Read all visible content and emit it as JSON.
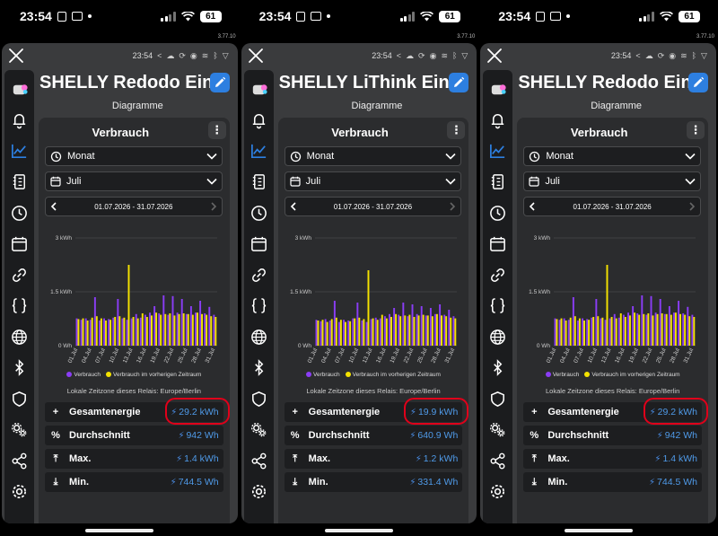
{
  "panels": [
    {
      "status": {
        "time": "23:54",
        "battery": "61"
      },
      "version": "3.77.10",
      "topbar_time": "23:54",
      "title": "SHELLY Redodo Ein...",
      "subtitle": "Diagramme",
      "card_title": "Verbrauch",
      "period_select": "Monat",
      "month_select": "Juli",
      "date_range": "01.07.2026 - 31.07.2026",
      "y_ticks": [
        "3 kWh",
        "1.5 kWh",
        "0 Wh"
      ],
      "x_ticks": [
        "01.Jul",
        "04.Jul",
        "07.Jul",
        "10.Jul",
        "13.Jul",
        "16.Jul",
        "19.Jul",
        "22.Jul",
        "25.Jul",
        "28.Jul",
        "31.Jul"
      ],
      "legend": {
        "current": "Verbrauch",
        "previous": "Verbrauch im vorherigen Zeitraum"
      },
      "timezone": "Lokale Zeitzone dieses Relais: Europe/Berlin",
      "stats": [
        {
          "label": "Gesamtenergie",
          "value": "29.2 kWh"
        },
        {
          "label": "Durchschnitt",
          "value": "942 Wh"
        },
        {
          "label": "Max.",
          "value": "1.4 kWh"
        },
        {
          "label": "Min.",
          "value": "744.5 Wh"
        }
      ],
      "chart_data": {
        "type": "bar",
        "ylim": [
          0,
          3000
        ],
        "unit": "Wh",
        "series": [
          {
            "name": "Verbrauch",
            "values": [
              760,
              720,
              760,
              720,
              1350,
              700,
              760,
              740,
              780,
              1300,
              760,
              720,
              760,
              880,
              780,
              860,
              920,
              1100,
              900,
              1400,
              860,
              1380,
              920,
              1300,
              880,
              1100,
              920,
              1250,
              900,
              1080,
              860
            ]
          },
          {
            "name": "Verbrauch im vorherigen Zeitraum",
            "values": [
              740,
              760,
              700,
              780,
              820,
              760,
              700,
              720,
              800,
              820,
              780,
              2250,
              800,
              760,
              900,
              800,
              840,
              920,
              860,
              880,
              900,
              840,
              880,
              900,
              880,
              860,
              920,
              880,
              860,
              820,
              800
            ]
          }
        ]
      }
    },
    {
      "status": {
        "time": "23:54",
        "battery": "61"
      },
      "version": "3.77.10",
      "topbar_time": "23:54",
      "title": "SHELLY LiThink Ein...",
      "subtitle": "Diagramme",
      "card_title": "Verbrauch",
      "period_select": "Monat",
      "month_select": "Juli",
      "date_range": "01.07.2026 - 31.07.2026",
      "y_ticks": [
        "3 kWh",
        "1.5 kWh",
        "0 Wh"
      ],
      "x_ticks": [
        "01.Jul",
        "04.Jul",
        "07.Jul",
        "10.Jul",
        "13.Jul",
        "16.Jul",
        "19.Jul",
        "22.Jul",
        "25.Jul",
        "28.Jul",
        "31.Jul"
      ],
      "legend": {
        "current": "Verbrauch",
        "previous": "Verbrauch im vorherigen Zeitraum"
      },
      "timezone": "Lokale Zeitzone dieses Relais: Europe/Berlin",
      "stats": [
        {
          "label": "Gesamtenergie",
          "value": "19.9 kWh"
        },
        {
          "label": "Durchschnitt",
          "value": "640.9 Wh"
        },
        {
          "label": "Max.",
          "value": "1.2 kWh"
        },
        {
          "label": "Min.",
          "value": "331.4 Wh"
        }
      ],
      "chart_data": {
        "type": "bar",
        "ylim": [
          0,
          3000
        ],
        "unit": "Wh",
        "series": [
          {
            "name": "Verbrauch",
            "values": [
              720,
              680,
              740,
              700,
              1250,
              660,
              720,
              700,
              760,
              1200,
              700,
              660,
              740,
              780,
              760,
              820,
              880,
              1050,
              860,
              1200,
              820,
              1150,
              880,
              1100,
              840,
              1050,
              880,
              1150,
              860,
              1000,
              820
            ]
          },
          {
            "name": "Verbrauch im vorherigen Zeitraum",
            "values": [
              700,
              720,
              660,
              740,
              780,
              720,
              660,
              680,
              760,
              780,
              740,
              2100,
              760,
              720,
              860,
              760,
              800,
              880,
              820,
              840,
              860,
              800,
              840,
              860,
              840,
              820,
              880,
              840,
              820,
              780,
              760
            ]
          }
        ]
      }
    },
    {
      "status": {
        "time": "23:54",
        "battery": "61"
      },
      "version": "3.77.10",
      "topbar_time": "23:54",
      "title": "SHELLY Redodo Ein...",
      "subtitle": "Diagramme",
      "card_title": "Verbrauch",
      "period_select": "Monat",
      "month_select": "Juli",
      "date_range": "01.07.2026 - 31.07.2026",
      "y_ticks": [
        "3 kWh",
        "1.5 kWh",
        "0 Wh"
      ],
      "x_ticks": [
        "01.Jul",
        "04.Jul",
        "07.Jul",
        "10.Jul",
        "13.Jul",
        "16.Jul",
        "19.Jul",
        "22.Jul",
        "25.Jul",
        "28.Jul",
        "31.Jul"
      ],
      "legend": {
        "current": "Verbrauch",
        "previous": "Verbrauch im vorherigen Zeitraum"
      },
      "timezone": "Lokale Zeitzone dieses Relais: Europe/Berlin",
      "stats": [
        {
          "label": "Gesamtenergie",
          "value": "29.2 kWh"
        },
        {
          "label": "Durchschnitt",
          "value": "942 Wh"
        },
        {
          "label": "Max.",
          "value": "1.4 kWh"
        },
        {
          "label": "Min.",
          "value": "744.5 Wh"
        }
      ],
      "chart_data": {
        "type": "bar",
        "ylim": [
          0,
          3000
        ],
        "unit": "Wh",
        "series": [
          {
            "name": "Verbrauch",
            "values": [
              760,
              720,
              760,
              720,
              1350,
              700,
              760,
              740,
              780,
              1300,
              760,
              720,
              760,
              880,
              780,
              860,
              920,
              1100,
              900,
              1400,
              860,
              1380,
              920,
              1300,
              880,
              1100,
              920,
              1250,
              900,
              1080,
              860
            ]
          },
          {
            "name": "Verbrauch im vorherigen Zeitraum",
            "values": [
              740,
              760,
              700,
              780,
              820,
              760,
              700,
              720,
              800,
              820,
              780,
              2250,
              800,
              760,
              900,
              800,
              840,
              920,
              860,
              880,
              900,
              840,
              880,
              900,
              880,
              860,
              920,
              880,
              860,
              820,
              800
            ]
          }
        ]
      }
    }
  ],
  "colors": {
    "current": "#8a3df5",
    "previous": "#f4e200",
    "accent": "#2d7fe0",
    "value": "#4f9ae8",
    "highlight": "#e0001a"
  },
  "nav_icons": [
    "device-icon",
    "bell-icon",
    "chart-icon",
    "schedule-icon",
    "clock-icon",
    "calendar-icon",
    "link-icon",
    "braces-icon",
    "globe-icon",
    "bluetooth-icon",
    "shield-icon",
    "gears-icon",
    "share-icon",
    "settings-icon"
  ],
  "stat_icons": [
    "plus-icon",
    "percent-icon",
    "arrow-up-bar-icon",
    "arrow-down-bar-icon"
  ]
}
